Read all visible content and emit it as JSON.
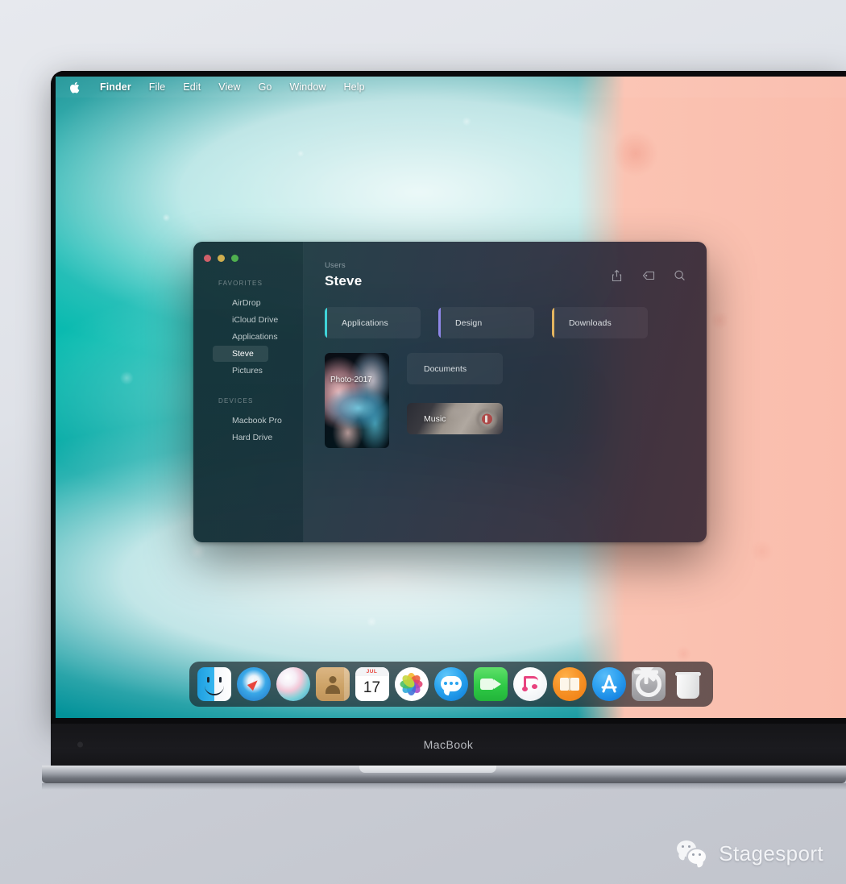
{
  "menubar": {
    "apple_icon": "apple-logo-icon",
    "items": [
      {
        "label": "Finder",
        "bold": true
      },
      {
        "label": "File",
        "bold": false
      },
      {
        "label": "Edit",
        "bold": false
      },
      {
        "label": "View",
        "bold": false
      },
      {
        "label": "Go",
        "bold": false
      },
      {
        "label": "Window",
        "bold": false
      },
      {
        "label": "Help",
        "bold": false
      }
    ]
  },
  "finder": {
    "traffic_lights": {
      "close": "#d0606a",
      "minimize": "#cfae4f",
      "maximize": "#4fb04f"
    },
    "sidebar": {
      "sections": [
        {
          "title": "FAVORITES",
          "items": [
            {
              "label": "AirDrop",
              "active": false
            },
            {
              "label": "iCloud Drive",
              "active": false
            },
            {
              "label": "Applications",
              "active": false
            },
            {
              "label": "Steve",
              "active": true
            },
            {
              "label": "Pictures",
              "active": false
            }
          ]
        },
        {
          "title": "DEVICES",
          "items": [
            {
              "label": "Macbook Pro",
              "active": false
            },
            {
              "label": "Hard Drive",
              "active": false
            }
          ]
        }
      ]
    },
    "header": {
      "breadcrumb": "Users",
      "title": "Steve",
      "tools": [
        {
          "name": "share-icon"
        },
        {
          "name": "tag-icon"
        },
        {
          "name": "search-icon"
        }
      ]
    },
    "folder_cards": [
      {
        "label": "Applications",
        "accent": "#3fd3d8"
      },
      {
        "label": "Design",
        "accent": "#8e87e8"
      },
      {
        "label": "Downloads",
        "accent": "#e3b45f"
      }
    ],
    "photo_card": {
      "label": "Photo-2017"
    },
    "documents_card": {
      "label": "Documents"
    },
    "music_card": {
      "label": "Music"
    }
  },
  "dock": {
    "items": [
      {
        "label": "Finder",
        "icon": "finder-icon"
      },
      {
        "label": "Safari",
        "icon": "safari-icon"
      },
      {
        "label": "Siri",
        "icon": "siri-icon"
      },
      {
        "label": "Contacts",
        "icon": "contacts-icon"
      },
      {
        "label": "Calendar",
        "icon": "calendar-icon",
        "month": "JUL",
        "day": "17"
      },
      {
        "label": "Photos",
        "icon": "photos-icon"
      },
      {
        "label": "Messages",
        "icon": "messages-icon"
      },
      {
        "label": "FaceTime",
        "icon": "facetime-icon"
      },
      {
        "label": "iTunes",
        "icon": "itunes-icon"
      },
      {
        "label": "iBooks",
        "icon": "ibooks-icon"
      },
      {
        "label": "App Store",
        "icon": "appstore-icon"
      },
      {
        "label": "System Preferences",
        "icon": "system-preferences-icon"
      },
      {
        "label": "Trash",
        "icon": "trash-icon"
      }
    ]
  },
  "device": {
    "label": "MacBook"
  },
  "watermark": {
    "icon": "wechat-icon",
    "text": "Stagesport"
  }
}
